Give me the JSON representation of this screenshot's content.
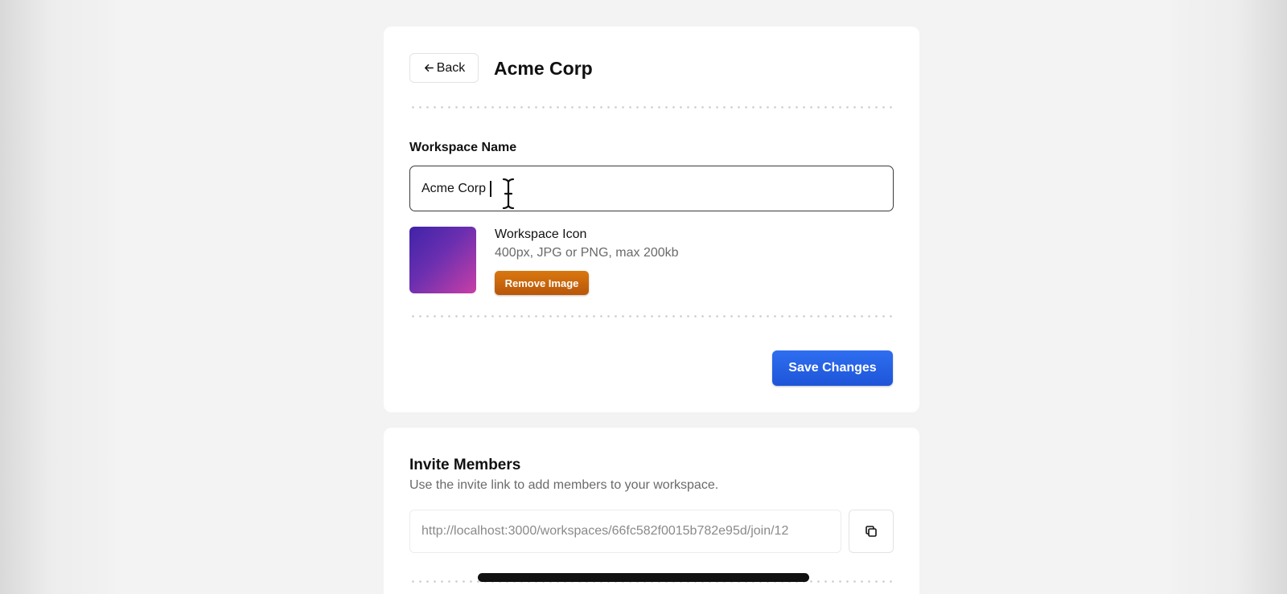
{
  "header": {
    "back_label": "Back",
    "title": "Acme Corp"
  },
  "workspace_name": {
    "label": "Workspace Name",
    "value": "Acme Corp"
  },
  "workspace_icon": {
    "title": "Workspace Icon",
    "hint": "400px, JPG or PNG, max 200kb",
    "remove_label": "Remove Image",
    "gradient_colors": [
      "#3f23a8",
      "#c93fa6"
    ]
  },
  "actions": {
    "save_label": "Save Changes"
  },
  "invite": {
    "title": "Invite Members",
    "description": "Use the invite link to add members to your workspace.",
    "link": "http://localhost:3000/workspaces/66fc582f0015b782e95d/join/12",
    "copy_icon": "copy-icon"
  },
  "colors": {
    "primary": "#1e55d8",
    "warning": "#c4620c",
    "background": "#f3f3f3"
  }
}
